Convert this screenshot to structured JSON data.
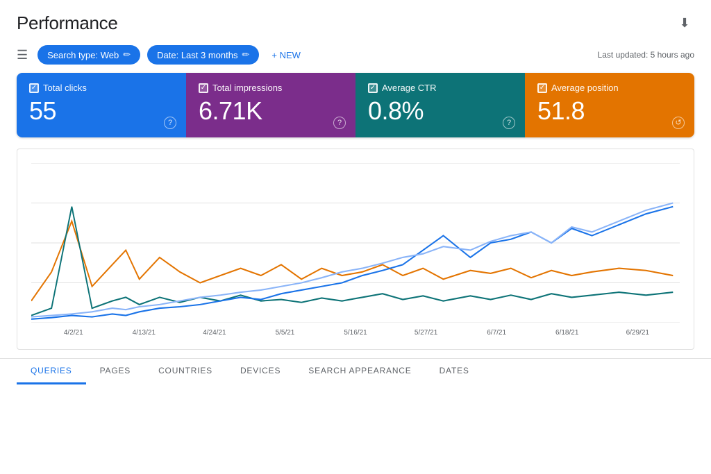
{
  "header": {
    "title": "Performance",
    "download_icon": "⬇"
  },
  "toolbar": {
    "filter_icon": "≡",
    "chips": [
      {
        "label": "Search type: Web",
        "edit_icon": "✎"
      },
      {
        "label": "Date: Last 3 months",
        "edit_icon": "✎"
      }
    ],
    "new_button_label": "+ NEW",
    "last_updated": "Last updated: 5 hours ago"
  },
  "metric_cards": [
    {
      "id": "total-clicks",
      "label": "Total clicks",
      "value": "55",
      "color": "blue"
    },
    {
      "id": "total-impressions",
      "label": "Total impressions",
      "value": "6.71K",
      "color": "purple"
    },
    {
      "id": "average-ctr",
      "label": "Average CTR",
      "value": "0.8%",
      "color": "teal"
    },
    {
      "id": "average-position",
      "label": "Average position",
      "value": "51.8",
      "color": "orange"
    }
  ],
  "chart": {
    "x_labels": [
      "4/2/21",
      "4/13/21",
      "4/24/21",
      "5/5/21",
      "5/16/21",
      "5/27/21",
      "6/7/21",
      "6/18/21",
      "6/29/21"
    ]
  },
  "bottom_tabs": [
    {
      "label": "QUERIES",
      "active": true
    },
    {
      "label": "PAGES",
      "active": false
    },
    {
      "label": "COUNTRIES",
      "active": false
    },
    {
      "label": "DEVICES",
      "active": false
    },
    {
      "label": "SEARCH APPEARANCE",
      "active": false
    },
    {
      "label": "DATES",
      "active": false
    }
  ]
}
